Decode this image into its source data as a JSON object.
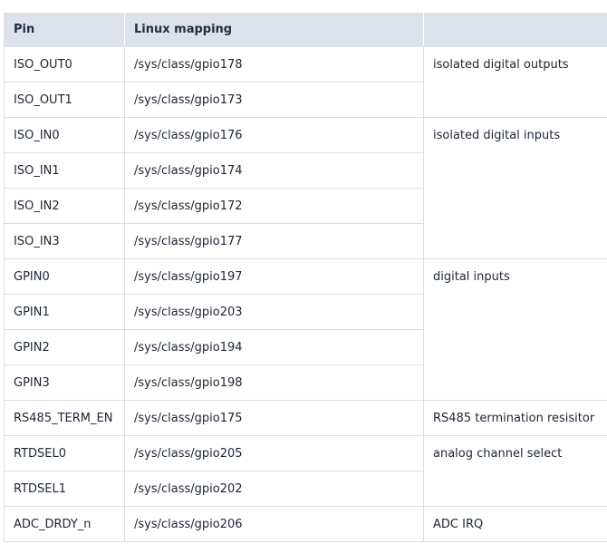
{
  "table": {
    "headers": [
      "Pin",
      "Linux mapping",
      ""
    ],
    "rows": [
      {
        "pin": "ISO_OUT0",
        "map": "/sys/class/gpio178",
        "desc": "isolated digital outputs",
        "span": 2
      },
      {
        "pin": "ISO_OUT1",
        "map": "/sys/class/gpio173"
      },
      {
        "pin": "ISO_IN0",
        "map": "/sys/class/gpio176",
        "desc": "isolated digital inputs",
        "span": 4
      },
      {
        "pin": "ISO_IN1",
        "map": "/sys/class/gpio174"
      },
      {
        "pin": "ISO_IN2",
        "map": "/sys/class/gpio172"
      },
      {
        "pin": "ISO_IN3",
        "map": "/sys/class/gpio177"
      },
      {
        "pin": "GPIN0",
        "map": "/sys/class/gpio197",
        "desc": "digital inputs",
        "span": 4
      },
      {
        "pin": "GPIN1",
        "map": "/sys/class/gpio203"
      },
      {
        "pin": "GPIN2",
        "map": "/sys/class/gpio194"
      },
      {
        "pin": "GPIN3",
        "map": "/sys/class/gpio198"
      },
      {
        "pin": "RS485_TERM_EN",
        "map": "/sys/class/gpio175",
        "desc": "RS485 termination resisitor",
        "span": 1
      },
      {
        "pin": "RTDSEL0",
        "map": "/sys/class/gpio205",
        "desc": "analog channel select",
        "span": 2
      },
      {
        "pin": "RTDSEL1",
        "map": "/sys/class/gpio202"
      },
      {
        "pin": "ADC_DRDY_n",
        "map": "/sys/class/gpio206",
        "desc": "ADC IRQ",
        "span": 1
      }
    ]
  }
}
